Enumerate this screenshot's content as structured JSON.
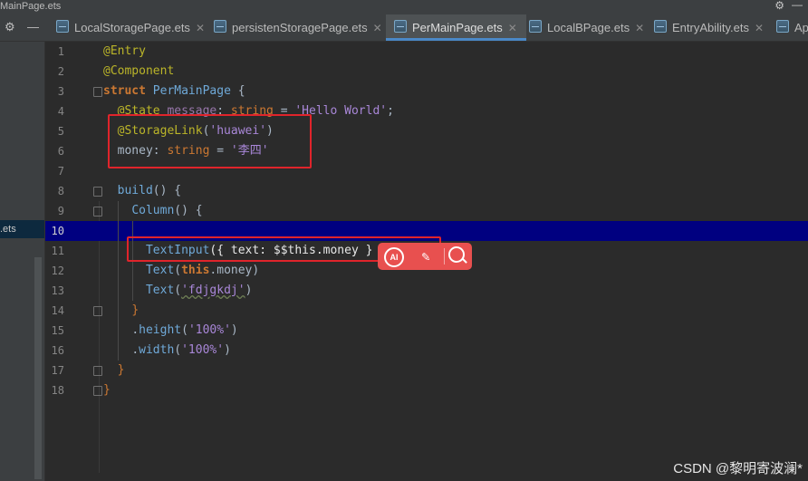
{
  "window": {
    "title": "MainPage.ets"
  },
  "tabs": [
    {
      "label": "LocalStoragePage.ets",
      "active": false
    },
    {
      "label": "persistenStoragePage.ets",
      "active": false
    },
    {
      "label": "PerMainPage.ets",
      "active": true
    },
    {
      "label": "LocalBPage.ets",
      "active": false
    },
    {
      "label": "EntryAbility.ets",
      "active": false
    },
    {
      "label": "Ap",
      "active": false
    }
  ],
  "sidebar": {
    "selected_item": ".ets"
  },
  "editor": {
    "current_line": 10,
    "line_numbers": [
      "1",
      "2",
      "3",
      "4",
      "5",
      "6",
      "7",
      "8",
      "9",
      "10",
      "11",
      "12",
      "13",
      "14",
      "15",
      "16",
      "17",
      "18"
    ],
    "code": {
      "l1_entry": "@Entry",
      "l2_component": "@Component",
      "l3_struct_kw": "struct",
      "l3_struct_name": "PerMainPage",
      "l3_brace": "{",
      "l4_decorator": "@State",
      "l4_name": "message",
      "l4_colon": ":",
      "l4_type": "string",
      "l4_eq": "=",
      "l4_value": "'Hello World'",
      "l4_semi": ";",
      "l5_decorator": "@StorageLink",
      "l5_paren_open": "(",
      "l5_arg": "'huawei'",
      "l5_paren_close": ")",
      "l6_name": "money",
      "l6_colon": ":",
      "l6_type": "string",
      "l6_eq": "=",
      "l6_value": "'李四'",
      "l8_fn": "build",
      "l8_rest": "() {",
      "l9_fn": "Column",
      "l9_rest": "() {",
      "l11_fn": "TextInput",
      "l11_rest": "({ text: $$this.money }",
      "l12_fn": "Text",
      "l12_open": "(",
      "l12_this": "this",
      "l12_rest": ".money)",
      "l13_fn": "Text",
      "l13_open": "(",
      "l13_arg": "'fdjgkdj'",
      "l13_close": ")",
      "l14_close": "}",
      "l15_dot": ".",
      "l15_method": "height",
      "l15_open": "(",
      "l15_arg": "'100%'",
      "l15_close": ")",
      "l16_dot": ".",
      "l16_method": "width",
      "l16_open": "(",
      "l16_arg": "'100%'",
      "l16_close": ")",
      "l17_close": "}",
      "l18_close": "}"
    }
  },
  "floating_toolbar": {
    "ai_label": "AI"
  },
  "watermark": "CSDN @黎明寄波澜*",
  "colors": {
    "highlight_box": "#e0242b",
    "current_line": "#000080",
    "toolbar": "#e8504f",
    "active_tab_underline": "#4a88c7"
  },
  "icons": [
    "settings-icon",
    "minimize-icon",
    "ets-file-icon",
    "close-icon",
    "ai-assistant-icon",
    "magic-wand-icon",
    "search-icon",
    "fold-marker-icon"
  ]
}
